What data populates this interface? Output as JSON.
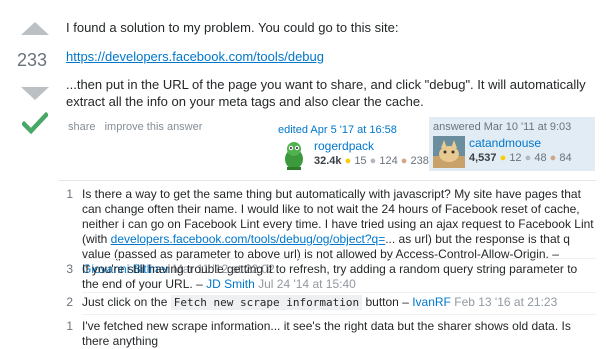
{
  "answer": {
    "score": "233",
    "paragraph1": "I found a solution to my problem. You could go to this site:",
    "link": "https://developers.facebook.com/tools/debug",
    "paragraph3": "...then put in the URL of the page you want to share, and click \"debug\". It will automatically extract all the info on your meta tags and also clear the cache.",
    "menu": {
      "share": "share",
      "improve": "improve this answer"
    },
    "edited": {
      "label": "edited Apr 5 '17 at 16:58",
      "user": "rogerdpack",
      "rep": "32.4k",
      "gold": "15",
      "silver": "124",
      "bronze": "238"
    },
    "answered": {
      "label": "answered Mar 10 '11 at 9:03",
      "user": "catandmouse",
      "rep": "4,537",
      "gold": "12",
      "silver": "48",
      "bronze": "84"
    }
  },
  "comments": [
    {
      "votes": "1",
      "text_a": "Is there a way to get the same thing but automatically with javascript? My site have pages that can change often their name. I would like to not wait the 24 hours of Facebook reset of cache, neither i can go on Facebook Lint every time. I have tried using an ajax request to Facebook Lint (with ",
      "link": "developers.facebook.com/tools/debug/og/object?q=",
      "text_b": "... as url) but the response is that q value (passed as parameter to above url) is not allowed by Access-Control-Allow-Origin.",
      "dash": " – ",
      "user": "Giovanni Bitliner",
      "date": "Mar 11 '12 at 22:02"
    },
    {
      "votes": "3",
      "text": "If you're still having trouble getting it to refresh, try adding a random query string parameter to the end of your URL.",
      "dash": " – ",
      "user": "JD Smith",
      "date": "Jul 24 '14 at 15:40"
    },
    {
      "votes": "2",
      "text_a": "Just click on the ",
      "code": "Fetch new scrape information",
      "text_b": " button",
      "dash": " – ",
      "user": "IvanRF",
      "date": "Feb 13 '16 at 21:23"
    },
    {
      "votes": "1",
      "text": "I've fetched new scrape information... it see's the right data but the sharer shows old data. Is there anything"
    }
  ],
  "colors": {
    "link": "#0077cc",
    "accepted": "#48a868",
    "signature_bg": "#e1ecf4"
  }
}
